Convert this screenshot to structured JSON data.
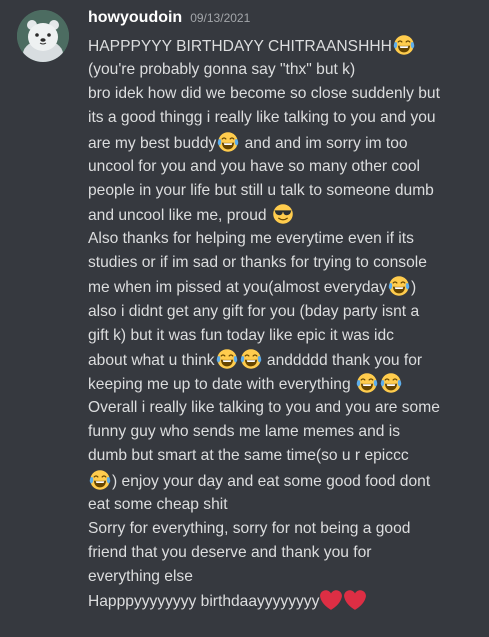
{
  "message": {
    "username": "howyoudoin",
    "timestamp": "09/13/2021",
    "avatar_icon": "polar-bear-avatar",
    "lines": [
      [
        {
          "t": "HAPPPYYY BIRTHDAYY CHITRAANSHHH"
        },
        {
          "e": "joy"
        }
      ],
      [
        {
          "t": "(you're probably gonna say \"thx\" but k)"
        }
      ],
      [
        {
          "t": "bro idek how did we become so close suddenly but"
        }
      ],
      [
        {
          "t": "its a good thingg i really like talking to you and you"
        }
      ],
      [
        {
          "t": "are my best buddy"
        },
        {
          "e": "joy"
        },
        {
          "t": " and and im sorry im too"
        }
      ],
      [
        {
          "t": "uncool for you and you have so many other cool"
        }
      ],
      [
        {
          "t": "people in your life but still u talk to someone dumb"
        }
      ],
      [
        {
          "t": "and uncool like me, proud "
        },
        {
          "e": "sunglasses"
        }
      ],
      [
        {
          "t": "Also thanks for helping me everytime even if its"
        }
      ],
      [
        {
          "t": "studies or if im sad or thanks for trying to console"
        }
      ],
      [
        {
          "t": "me when im pissed at you(almost everyday"
        },
        {
          "e": "joy"
        },
        {
          "t": ")"
        }
      ],
      [
        {
          "t": "also i didnt get any gift for you (bday party isnt a"
        }
      ],
      [
        {
          "t": "gift k) but it was fun today like epic it was idc"
        }
      ],
      [
        {
          "t": "about what u think"
        },
        {
          "e": "joy"
        },
        {
          "e": "joy"
        },
        {
          "t": " anddddd thank you for"
        }
      ],
      [
        {
          "t": "keeping me up to date with everything "
        },
        {
          "e": "joy"
        },
        {
          "e": "joy"
        }
      ],
      [
        {
          "t": "Overall i really like talking to you and you are some"
        }
      ],
      [
        {
          "t": "funny guy who sends me lame memes and is"
        }
      ],
      [
        {
          "t": "dumb but smart at the same time(so u r epiccc"
        }
      ],
      [
        {
          "e": "joy"
        },
        {
          "t": ") enjoy your day and eat some good food dont"
        }
      ],
      [
        {
          "t": "eat some cheap shit"
        }
      ],
      [
        {
          "t": "Sorry for everything, sorry for not being a good"
        }
      ],
      [
        {
          "t": "friend that you deserve and thank you for"
        }
      ],
      [
        {
          "t": "everything else"
        }
      ],
      [
        {
          "t": "Happpyyyyyyyy birthdaayyyyyyyy"
        },
        {
          "e": "heart"
        },
        {
          "e": "heart"
        }
      ]
    ]
  },
  "colors": {
    "background": "#36393f",
    "username": "#ffffff",
    "timestamp": "#a3a6aa",
    "text": "#dcddde",
    "heart": "#dd2e44",
    "emoji_face": "#ffcc4d",
    "tears": "#5dadec"
  }
}
